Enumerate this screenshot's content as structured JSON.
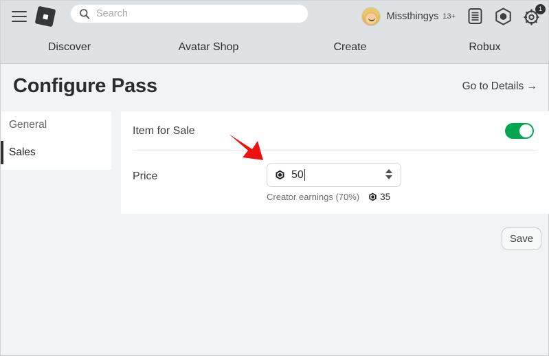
{
  "topbar": {
    "menu_icon": "hamburger-menu-icon",
    "logo_icon": "roblox-logo-icon",
    "search": {
      "placeholder": "Search",
      "value": "",
      "icon": "search-icon"
    },
    "user": {
      "name": "Missthingys",
      "age_badge": "13+",
      "avatar_icon": "avatar"
    },
    "icons": [
      {
        "name": "list-icon",
        "label": ""
      },
      {
        "name": "robux-hexagon-icon",
        "label": ""
      },
      {
        "name": "gear-icon",
        "label": "",
        "badge": "1"
      }
    ]
  },
  "nav": {
    "items": [
      {
        "label": "Discover"
      },
      {
        "label": "Avatar Shop"
      },
      {
        "label": "Create"
      },
      {
        "label": "Robux"
      }
    ]
  },
  "page": {
    "title": "Configure Pass",
    "details_link": "Go to Details →"
  },
  "sidebar": {
    "items": [
      {
        "label": "General",
        "active": false
      },
      {
        "label": "Sales",
        "active": true
      }
    ]
  },
  "main": {
    "item_for_sale": {
      "label": "Item for Sale",
      "toggle_on": true
    },
    "price": {
      "label": "Price",
      "value": "50",
      "currency_icon": "robux-icon",
      "spinner_up_icon": "spinner-up-icon",
      "spinner_down_icon": "spinner-down-icon"
    },
    "creator_earnings": {
      "label": "Creator earnings (70%)",
      "value": "35",
      "currency_icon": "robux-icon"
    }
  },
  "footer": {
    "save_label": "Save"
  },
  "annotation": {
    "arrow_icon": "red-pointer-arrow",
    "color": "#ee1111"
  },
  "colors": {
    "toggle_on": "#00a650",
    "topbar_bg": "#dfe2e5",
    "page_bg": "#f2f3f4",
    "card_bg": "#ffffff",
    "text": "#2a2c2f"
  }
}
